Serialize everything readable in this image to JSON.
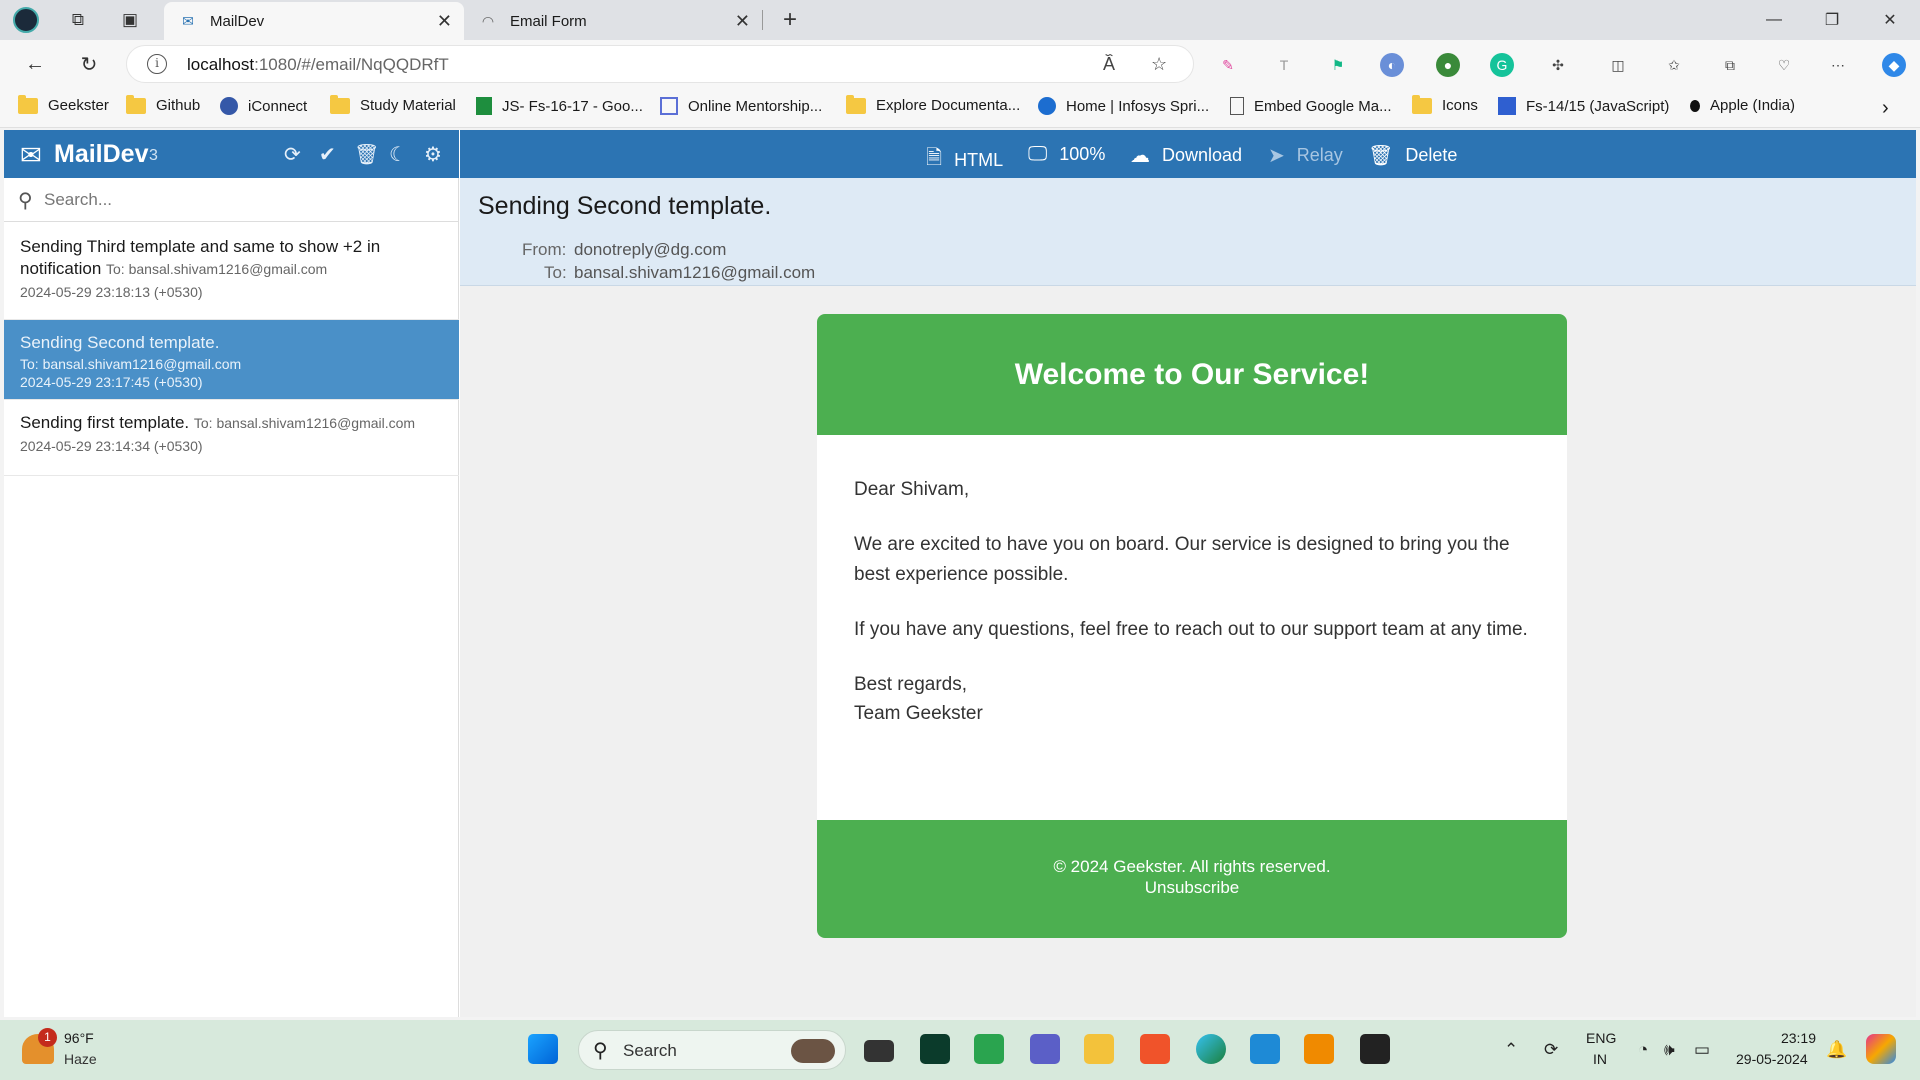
{
  "browser": {
    "tabs": [
      {
        "title": "MailDev",
        "active": true
      },
      {
        "title": "Email Form",
        "active": false
      }
    ],
    "url_host": "localhost",
    "url_path": ":1080/#/email/NqQQDRfT",
    "bookmarks": [
      {
        "label": "Geekster",
        "icon": "folder-icon"
      },
      {
        "label": "Github",
        "icon": "folder-icon"
      },
      {
        "label": "iConnect",
        "icon": "app-icon"
      },
      {
        "label": "Study Material",
        "icon": "folder-icon"
      },
      {
        "label": "JS- Fs-16-17 - Goo...",
        "icon": "sheets-icon"
      },
      {
        "label": "Online Mentorship...",
        "icon": "calendar-icon"
      },
      {
        "label": "Explore Documenta...",
        "icon": "folder-icon"
      },
      {
        "label": "Home | Infosys Spri...",
        "icon": "site-icon"
      },
      {
        "label": "Embed Google Ma...",
        "icon": "page-icon"
      },
      {
        "label": "Icons",
        "icon": "folder-icon"
      },
      {
        "label": "Fs-14/15 (JavaScript)",
        "icon": "profile-icon"
      },
      {
        "label": "Apple (India)",
        "icon": "apple-icon"
      }
    ]
  },
  "maildev": {
    "title": "MailDev",
    "count": "3",
    "search_placeholder": "Search...",
    "emails": [
      {
        "subject": "Sending Third template and same to show +2 in notification",
        "to": "To: bansal.shivam1216@gmail.com",
        "date": "2024-05-29 23:18:13 (+0530)"
      },
      {
        "subject": "Sending Second template.",
        "to": "To: bansal.shivam1216@gmail.com",
        "date": "2024-05-29 23:17:45 (+0530)"
      },
      {
        "subject": "Sending first template.",
        "to": "To: bansal.shivam1216@gmail.com",
        "date": "2024-05-29 23:14:34 (+0530)"
      }
    ],
    "actions": {
      "html": "HTML",
      "zoom": "100%",
      "download": "Download",
      "relay": "Relay",
      "delete": "Delete"
    },
    "selected": {
      "subject": "Sending Second template.",
      "from_label": "From:",
      "from": "donotreply@dg.com",
      "to_label": "To:",
      "to": "bansal.shivam1216@gmail.com"
    },
    "email_body": {
      "heading": "Welcome to Our Service!",
      "greeting": "Dear Shivam,",
      "p1": "We are excited to have you on board. Our service is designed to bring you the best experience possible.",
      "p2": "If you have any questions, feel free to reach out to our support team at any time.",
      "closing": "Best regards,",
      "signature": "Team Geekster",
      "footer": "© 2024 Geekster. All rights reserved.",
      "unsubscribe": "Unsubscribe"
    },
    "colors": {
      "header": "#2c74b3",
      "selected": "#4a90c8",
      "email_green": "#4caf50"
    }
  },
  "taskbar": {
    "weather_temp": "96°F",
    "weather_cond": "Haze",
    "weather_badge": "1",
    "search": "Search",
    "lang1": "ENG",
    "lang2": "IN",
    "time": "23:19",
    "date": "29-05-2024"
  }
}
